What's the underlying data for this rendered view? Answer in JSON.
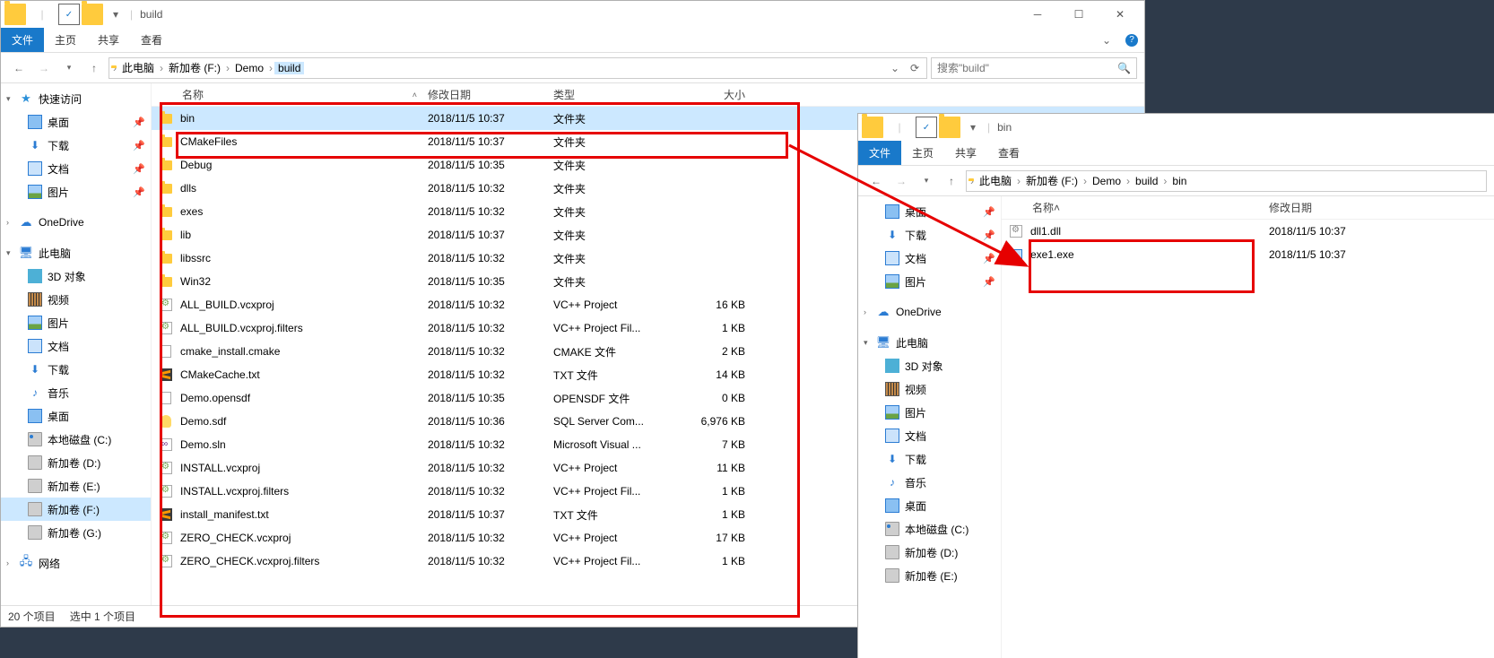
{
  "win1": {
    "title": "build",
    "ribbon": {
      "file": "文件",
      "home": "主页",
      "share": "共享",
      "view": "查看"
    },
    "breadcrumb": [
      "此电脑",
      "新加卷 (F:)",
      "Demo",
      "build"
    ],
    "breadcrumb_last": "build",
    "search_placeholder": "搜索\"build\"",
    "columns": {
      "name": "名称",
      "date": "修改日期",
      "type": "类型",
      "size": "大小"
    },
    "nav_quick": "快速访问",
    "nav_items_quick": [
      {
        "label": "桌面",
        "icon": "i-desktop",
        "pin": true
      },
      {
        "label": "下载",
        "icon": "i-dl",
        "pin": true,
        "glyph": "⬇"
      },
      {
        "label": "文档",
        "icon": "i-doc",
        "pin": true
      },
      {
        "label": "图片",
        "icon": "i-pic",
        "pin": true
      }
    ],
    "nav_onedrive": "OneDrive",
    "nav_thispc": "此电脑",
    "nav_items_pc": [
      {
        "label": "3D 对象",
        "icon": "i-3d"
      },
      {
        "label": "视频",
        "icon": "i-vid"
      },
      {
        "label": "图片",
        "icon": "i-pic"
      },
      {
        "label": "文档",
        "icon": "i-doc"
      },
      {
        "label": "下载",
        "icon": "i-dl",
        "glyph": "⬇"
      },
      {
        "label": "音乐",
        "icon": "i-music",
        "glyph": "♪"
      },
      {
        "label": "桌面",
        "icon": "i-desktop"
      },
      {
        "label": "本地磁盘 (C:)",
        "icon": "i-drive2"
      },
      {
        "label": "新加卷 (D:)",
        "icon": "i-drive"
      },
      {
        "label": "新加卷 (E:)",
        "icon": "i-drive"
      },
      {
        "label": "新加卷 (F:)",
        "icon": "i-drive",
        "sel": true
      },
      {
        "label": "新加卷 (G:)",
        "icon": "i-drive"
      }
    ],
    "nav_network": "网络",
    "files": [
      {
        "name": "bin",
        "date": "2018/11/5 10:37",
        "type": "文件夹",
        "size": "",
        "icon": "i-folder",
        "sel": true
      },
      {
        "name": "CMakeFiles",
        "date": "2018/11/5 10:37",
        "type": "文件夹",
        "size": "",
        "icon": "i-folder"
      },
      {
        "name": "Debug",
        "date": "2018/11/5 10:35",
        "type": "文件夹",
        "size": "",
        "icon": "i-folder"
      },
      {
        "name": "dlls",
        "date": "2018/11/5 10:32",
        "type": "文件夹",
        "size": "",
        "icon": "i-folder"
      },
      {
        "name": "exes",
        "date": "2018/11/5 10:32",
        "type": "文件夹",
        "size": "",
        "icon": "i-folder"
      },
      {
        "name": "lib",
        "date": "2018/11/5 10:37",
        "type": "文件夹",
        "size": "",
        "icon": "i-folder"
      },
      {
        "name": "libssrc",
        "date": "2018/11/5 10:32",
        "type": "文件夹",
        "size": "",
        "icon": "i-folder"
      },
      {
        "name": "Win32",
        "date": "2018/11/5 10:35",
        "type": "文件夹",
        "size": "",
        "icon": "i-folder"
      },
      {
        "name": "ALL_BUILD.vcxproj",
        "date": "2018/11/5 10:32",
        "type": "VC++ Project",
        "size": "16 KB",
        "icon": "i-proj"
      },
      {
        "name": "ALL_BUILD.vcxproj.filters",
        "date": "2018/11/5 10:32",
        "type": "VC++ Project Fil...",
        "size": "1 KB",
        "icon": "i-proj"
      },
      {
        "name": "cmake_install.cmake",
        "date": "2018/11/5 10:32",
        "type": "CMAKE 文件",
        "size": "2 KB",
        "icon": "i-file"
      },
      {
        "name": "CMakeCache.txt",
        "date": "2018/11/5 10:32",
        "type": "TXT 文件",
        "size": "14 KB",
        "icon": "i-sublime"
      },
      {
        "name": "Demo.opensdf",
        "date": "2018/11/5 10:35",
        "type": "OPENSDF 文件",
        "size": "0 KB",
        "icon": "i-file"
      },
      {
        "name": "Demo.sdf",
        "date": "2018/11/5 10:36",
        "type": "SQL Server Com...",
        "size": "6,976 KB",
        "icon": "i-db"
      },
      {
        "name": "Demo.sln",
        "date": "2018/11/5 10:32",
        "type": "Microsoft Visual ...",
        "size": "7 KB",
        "icon": "i-sln"
      },
      {
        "name": "INSTALL.vcxproj",
        "date": "2018/11/5 10:32",
        "type": "VC++ Project",
        "size": "11 KB",
        "icon": "i-proj"
      },
      {
        "name": "INSTALL.vcxproj.filters",
        "date": "2018/11/5 10:32",
        "type": "VC++ Project Fil...",
        "size": "1 KB",
        "icon": "i-proj"
      },
      {
        "name": "install_manifest.txt",
        "date": "2018/11/5 10:37",
        "type": "TXT 文件",
        "size": "1 KB",
        "icon": "i-sublime"
      },
      {
        "name": "ZERO_CHECK.vcxproj",
        "date": "2018/11/5 10:32",
        "type": "VC++ Project",
        "size": "17 KB",
        "icon": "i-proj"
      },
      {
        "name": "ZERO_CHECK.vcxproj.filters",
        "date": "2018/11/5 10:32",
        "type": "VC++ Project Fil...",
        "size": "1 KB",
        "icon": "i-proj"
      }
    ],
    "status_count": "20 个项目",
    "status_sel": "选中 1 个项目"
  },
  "win2": {
    "title": "bin",
    "ribbon": {
      "file": "文件",
      "home": "主页",
      "share": "共享",
      "view": "查看"
    },
    "breadcrumb": [
      "此电脑",
      "新加卷 (F:)",
      "Demo",
      "build",
      "bin"
    ],
    "columns": {
      "name": "名称",
      "date": "修改日期"
    },
    "nav_items_quick": [
      {
        "label": "桌面",
        "icon": "i-desktop",
        "pin": true
      },
      {
        "label": "下载",
        "icon": "i-dl",
        "pin": true,
        "glyph": "⬇"
      },
      {
        "label": "文档",
        "icon": "i-doc",
        "pin": true
      },
      {
        "label": "图片",
        "icon": "i-pic",
        "pin": true
      }
    ],
    "nav_onedrive": "OneDrive",
    "nav_thispc": "此电脑",
    "nav_items_pc": [
      {
        "label": "3D 对象",
        "icon": "i-3d"
      },
      {
        "label": "视频",
        "icon": "i-vid"
      },
      {
        "label": "图片",
        "icon": "i-pic"
      },
      {
        "label": "文档",
        "icon": "i-doc"
      },
      {
        "label": "下载",
        "icon": "i-dl",
        "glyph": "⬇"
      },
      {
        "label": "音乐",
        "icon": "i-music",
        "glyph": "♪"
      },
      {
        "label": "桌面",
        "icon": "i-desktop"
      },
      {
        "label": "本地磁盘 (C:)",
        "icon": "i-drive2"
      },
      {
        "label": "新加卷 (D:)",
        "icon": "i-drive"
      },
      {
        "label": "新加卷 (E:)",
        "icon": "i-drive"
      }
    ],
    "files": [
      {
        "name": "dll1.dll",
        "date": "2018/11/5 10:37",
        "icon": "i-dll"
      },
      {
        "name": "exe1.exe",
        "date": "2018/11/5 10:37",
        "icon": "i-exe"
      }
    ]
  }
}
